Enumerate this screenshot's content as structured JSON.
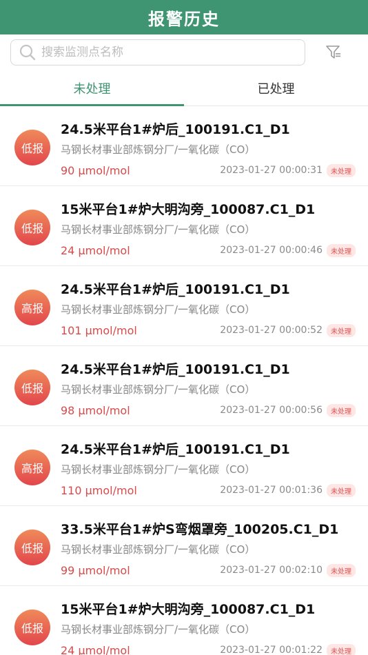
{
  "header": {
    "title": "报警历史"
  },
  "search": {
    "placeholder": "搜索监测点名称",
    "value": ""
  },
  "tabs": [
    {
      "label": "未处理",
      "active": true
    },
    {
      "label": "已处理",
      "active": false
    }
  ],
  "alarms": [
    {
      "level": "低报",
      "title": "24.5米平台1#炉后_100191.C1_D1",
      "sub": "马钢长材事业部炼钢分厂/一氧化碳（CO）",
      "value": "90 μmol/mol",
      "time": "2023-01-27 00:00:31",
      "status": "未处理"
    },
    {
      "level": "低报",
      "title": "15米平台1#炉大明沟旁_100087.C1_D1",
      "sub": "马钢长材事业部炼钢分厂/一氧化碳（CO）",
      "value": "24 μmol/mol",
      "time": "2023-01-27 00:00:46",
      "status": "未处理"
    },
    {
      "level": "高报",
      "title": "24.5米平台1#炉后_100191.C1_D1",
      "sub": "马钢长材事业部炼钢分厂/一氧化碳（CO）",
      "value": "101 μmol/mol",
      "time": "2023-01-27 00:00:52",
      "status": "未处理"
    },
    {
      "level": "低报",
      "title": "24.5米平台1#炉后_100191.C1_D1",
      "sub": "马钢长材事业部炼钢分厂/一氧化碳（CO）",
      "value": "98 μmol/mol",
      "time": "2023-01-27 00:00:56",
      "status": "未处理"
    },
    {
      "level": "高报",
      "title": "24.5米平台1#炉后_100191.C1_D1",
      "sub": "马钢长材事业部炼钢分厂/一氧化碳（CO）",
      "value": "110 μmol/mol",
      "time": "2023-01-27 00:01:36",
      "status": "未处理"
    },
    {
      "level": "低报",
      "title": "33.5米平台1#炉S弯烟罩旁_100205.C1_D1",
      "sub": "马钢长材事业部炼钢分厂/一氧化碳（CO）",
      "value": "99 μmol/mol",
      "time": "2023-01-27 00:02:10",
      "status": "未处理"
    },
    {
      "level": "低报",
      "title": "15米平台1#炉大明沟旁_100087.C1_D1",
      "sub": "马钢长材事业部炼钢分厂/一氧化碳（CO）",
      "value": "24 μmol/mol",
      "time": "2023-01-27 00:01:22",
      "status": "未处理"
    }
  ],
  "colors": {
    "brand": "#3f9472",
    "alarm": "#e2464c",
    "value": "#d84a4a"
  }
}
